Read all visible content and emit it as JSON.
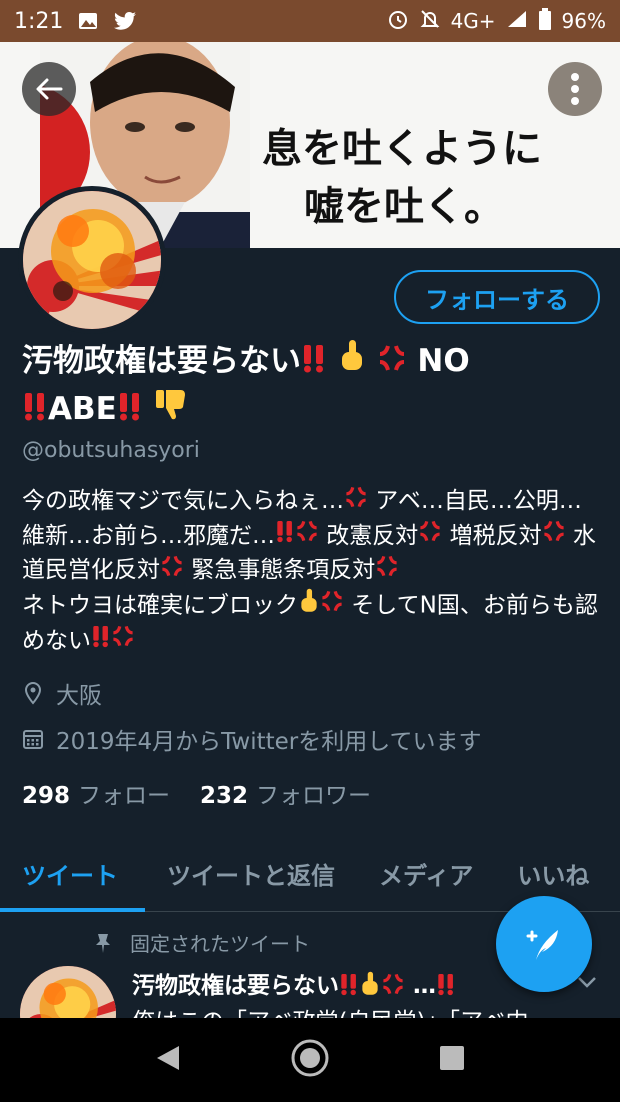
{
  "status_bar": {
    "time": "1:21",
    "network": "4G+",
    "battery": "96%"
  },
  "banner": {
    "line1": "息を吐くように",
    "line2": "嘘を吐く。"
  },
  "profile": {
    "follow_label": "フォローする",
    "name_line1": "汚物政権は要らない",
    "name_no": "NO",
    "name_abe": "ABE",
    "handle": "@obutsuhasyori",
    "bio_parts": {
      "p1": "今の政権マジで気に入らねぇ…",
      "p2": " アベ…自民…公明…維新…お前ら…邪魔だ…",
      "p3": " 改憲反対",
      "p4": " 増税反対",
      "p5": " 水道民営化反対",
      "p6": " 緊急事態条項反対",
      "p7": "ネトウヨは確実にブロック",
      "p8": " そしてN国、お前らも認めない"
    },
    "location": "大阪",
    "joined": "2019年4月からTwitterを利用しています",
    "following_count": "298",
    "following_label": "フォロー",
    "followers_count": "232",
    "followers_label": "フォロワー"
  },
  "tabs": {
    "tweets": "ツイート",
    "replies": "ツイートと返信",
    "media": "メディア",
    "likes": "いいね"
  },
  "pinned": {
    "label": "固定されたツイート",
    "name": "汚物政権は要らない",
    "name_tail": "…",
    "body": "俺はこの「アベ政党(自民党)」「アベ内"
  },
  "colors": {
    "background": "#15202b",
    "accent": "#1da1f2",
    "secondary_text": "#8899a6",
    "status_bar": "#7a4a2e"
  }
}
